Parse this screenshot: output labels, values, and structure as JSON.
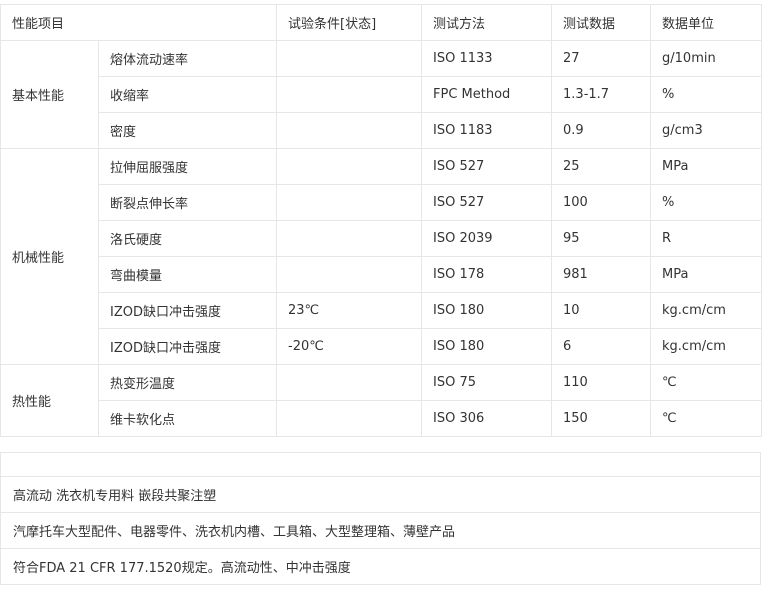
{
  "header": {
    "category": "性能项目",
    "condition": "试验条件[状态]",
    "method": "测试方法",
    "value": "测试数据",
    "unit": "数据单位"
  },
  "groups": [
    {
      "name": "基本性能",
      "rows": [
        {
          "item": "熔体流动速率",
          "condition": "",
          "method": "ISO 1133",
          "value": "27",
          "unit": "g/10min"
        },
        {
          "item": "收缩率",
          "condition": "",
          "method": "FPC Method",
          "value": "1.3-1.7",
          "unit": "%"
        },
        {
          "item": "密度",
          "condition": "",
          "method": "ISO 1183",
          "value": "0.9",
          "unit": "g/cm3"
        }
      ]
    },
    {
      "name": "机械性能",
      "rows": [
        {
          "item": "拉伸屈服强度",
          "condition": "",
          "method": "ISO 527",
          "value": "25",
          "unit": "MPa"
        },
        {
          "item": "断裂点伸长率",
          "condition": "",
          "method": "ISO 527",
          "value": "100",
          "unit": "%"
        },
        {
          "item": "洛氏硬度",
          "condition": "",
          "method": "ISO 2039",
          "value": "95",
          "unit": "R"
        },
        {
          "item": "弯曲模量",
          "condition": "",
          "method": "ISO 178",
          "value": "981",
          "unit": "MPa"
        },
        {
          "item": "IZOD缺口冲击强度",
          "condition": "23℃",
          "method": "ISO 180",
          "value": "10",
          "unit": "kg.cm/cm"
        },
        {
          "item": "IZOD缺口冲击强度",
          "condition": "-20℃",
          "method": "ISO 180",
          "value": "6",
          "unit": "kg.cm/cm"
        }
      ]
    },
    {
      "name": "热性能",
      "rows": [
        {
          "item": "热变形温度",
          "condition": "",
          "method": "ISO 75",
          "value": "110",
          "unit": "℃"
        },
        {
          "item": "维卡软化点",
          "condition": "",
          "method": "ISO 306",
          "value": "150",
          "unit": "℃"
        }
      ]
    }
  ],
  "notes": [
    "高流动 洗衣机专用料 嵌段共聚注塑",
    "汽摩托车大型配件、电器零件、洗衣机内槽、工具箱、大型整理箱、薄壁产品",
    "符合FDA 21 CFR 177.1520规定。高流动性、中冲击强度"
  ]
}
